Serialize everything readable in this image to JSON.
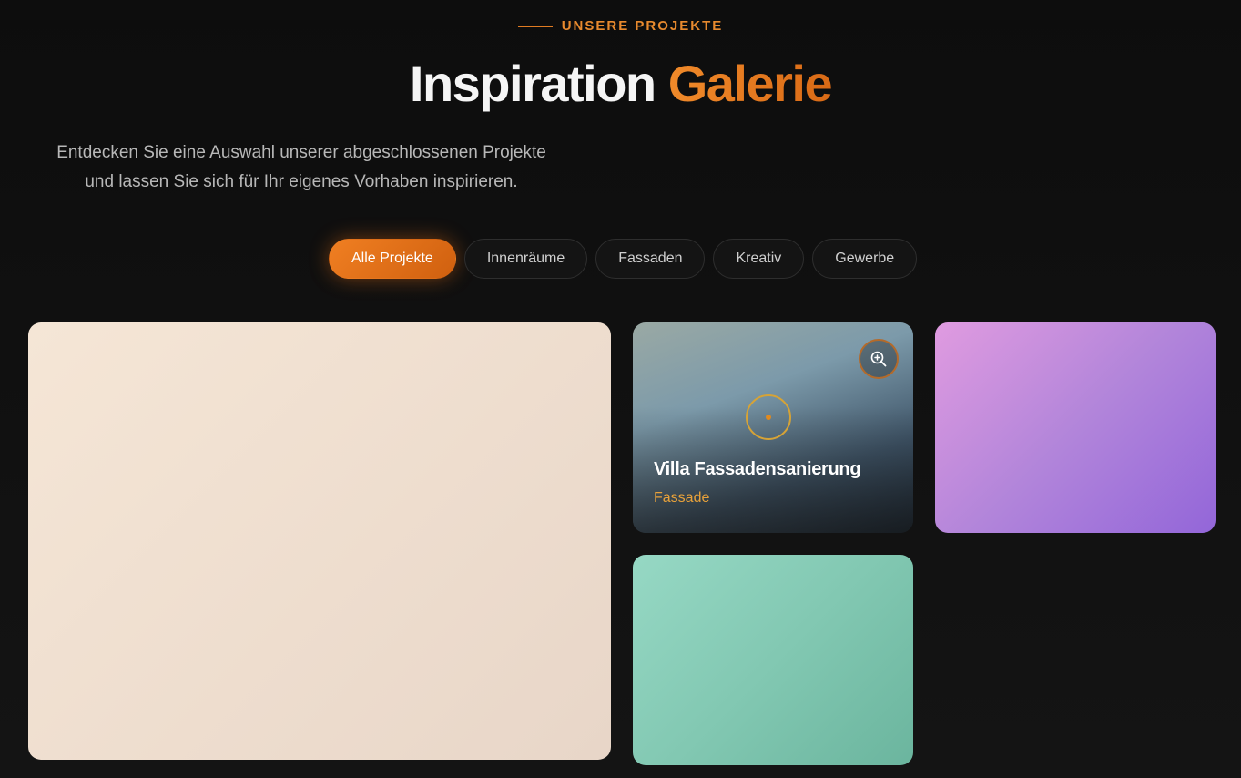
{
  "header": {
    "eyebrow": "UNSERE PROJEKTE",
    "title_part1": "Inspiration",
    "title_part2": "Galerie",
    "subtitle_line1": "Entdecken Sie eine Auswahl unserer abgeschlossenen Projekte",
    "subtitle_line2": "und lassen Sie sich für Ihr eigenes Vorhaben inspirieren."
  },
  "filters": [
    {
      "label": "Alle Projekte",
      "active": true
    },
    {
      "label": "Innenräume",
      "active": false
    },
    {
      "label": "Fassaden",
      "active": false
    },
    {
      "label": "Kreativ",
      "active": false
    },
    {
      "label": "Gewerbe",
      "active": false
    }
  ],
  "gallery": {
    "featured_card": {
      "title": "Villa Fassadensanierung",
      "category": "Fassade",
      "zoom_icon": "zoom-in-icon"
    }
  },
  "colors": {
    "accent": "#e07b22",
    "background": "#0d0d0d"
  }
}
